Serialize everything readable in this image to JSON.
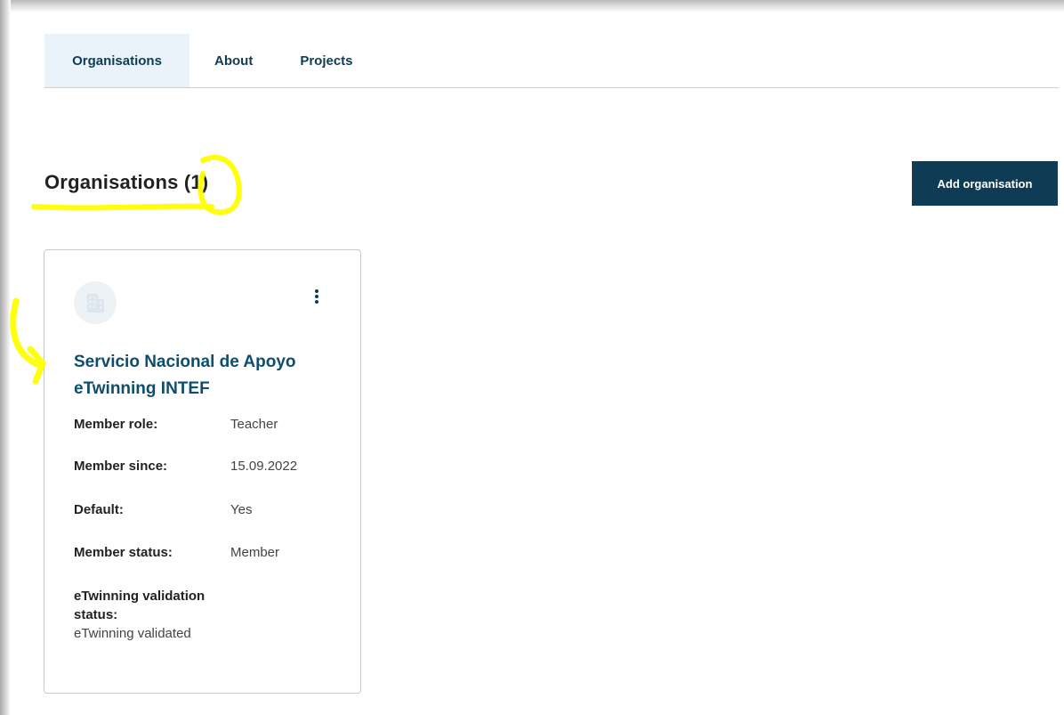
{
  "tabs": [
    {
      "label": "Organisations",
      "active": true
    },
    {
      "label": "About",
      "active": false
    },
    {
      "label": "Projects",
      "active": false
    }
  ],
  "page": {
    "heading": "Organisations (1)",
    "add_button_label": "Add organisation"
  },
  "organisation_card": {
    "name": "Servicio Nacional de Apoyo eTwinning INTEF",
    "avatar_icon": "building-icon",
    "menu_icon": "more-vertical-icon",
    "fields": [
      {
        "label": "Member role:",
        "value": "Teacher"
      },
      {
        "label": "Member since:",
        "value": "15.09.2022"
      },
      {
        "label": "Default:",
        "value": "Yes"
      },
      {
        "label": "Member status:",
        "value": "Member"
      }
    ],
    "validation": {
      "label": "eTwinning validation status:",
      "value": "eTwinning validated"
    }
  },
  "colors": {
    "brand_dark": "#0e3c55",
    "link": "#0e4d6e",
    "active_tab_bg": "#eaf3fa",
    "annotation_highlight": "#ffff00"
  }
}
